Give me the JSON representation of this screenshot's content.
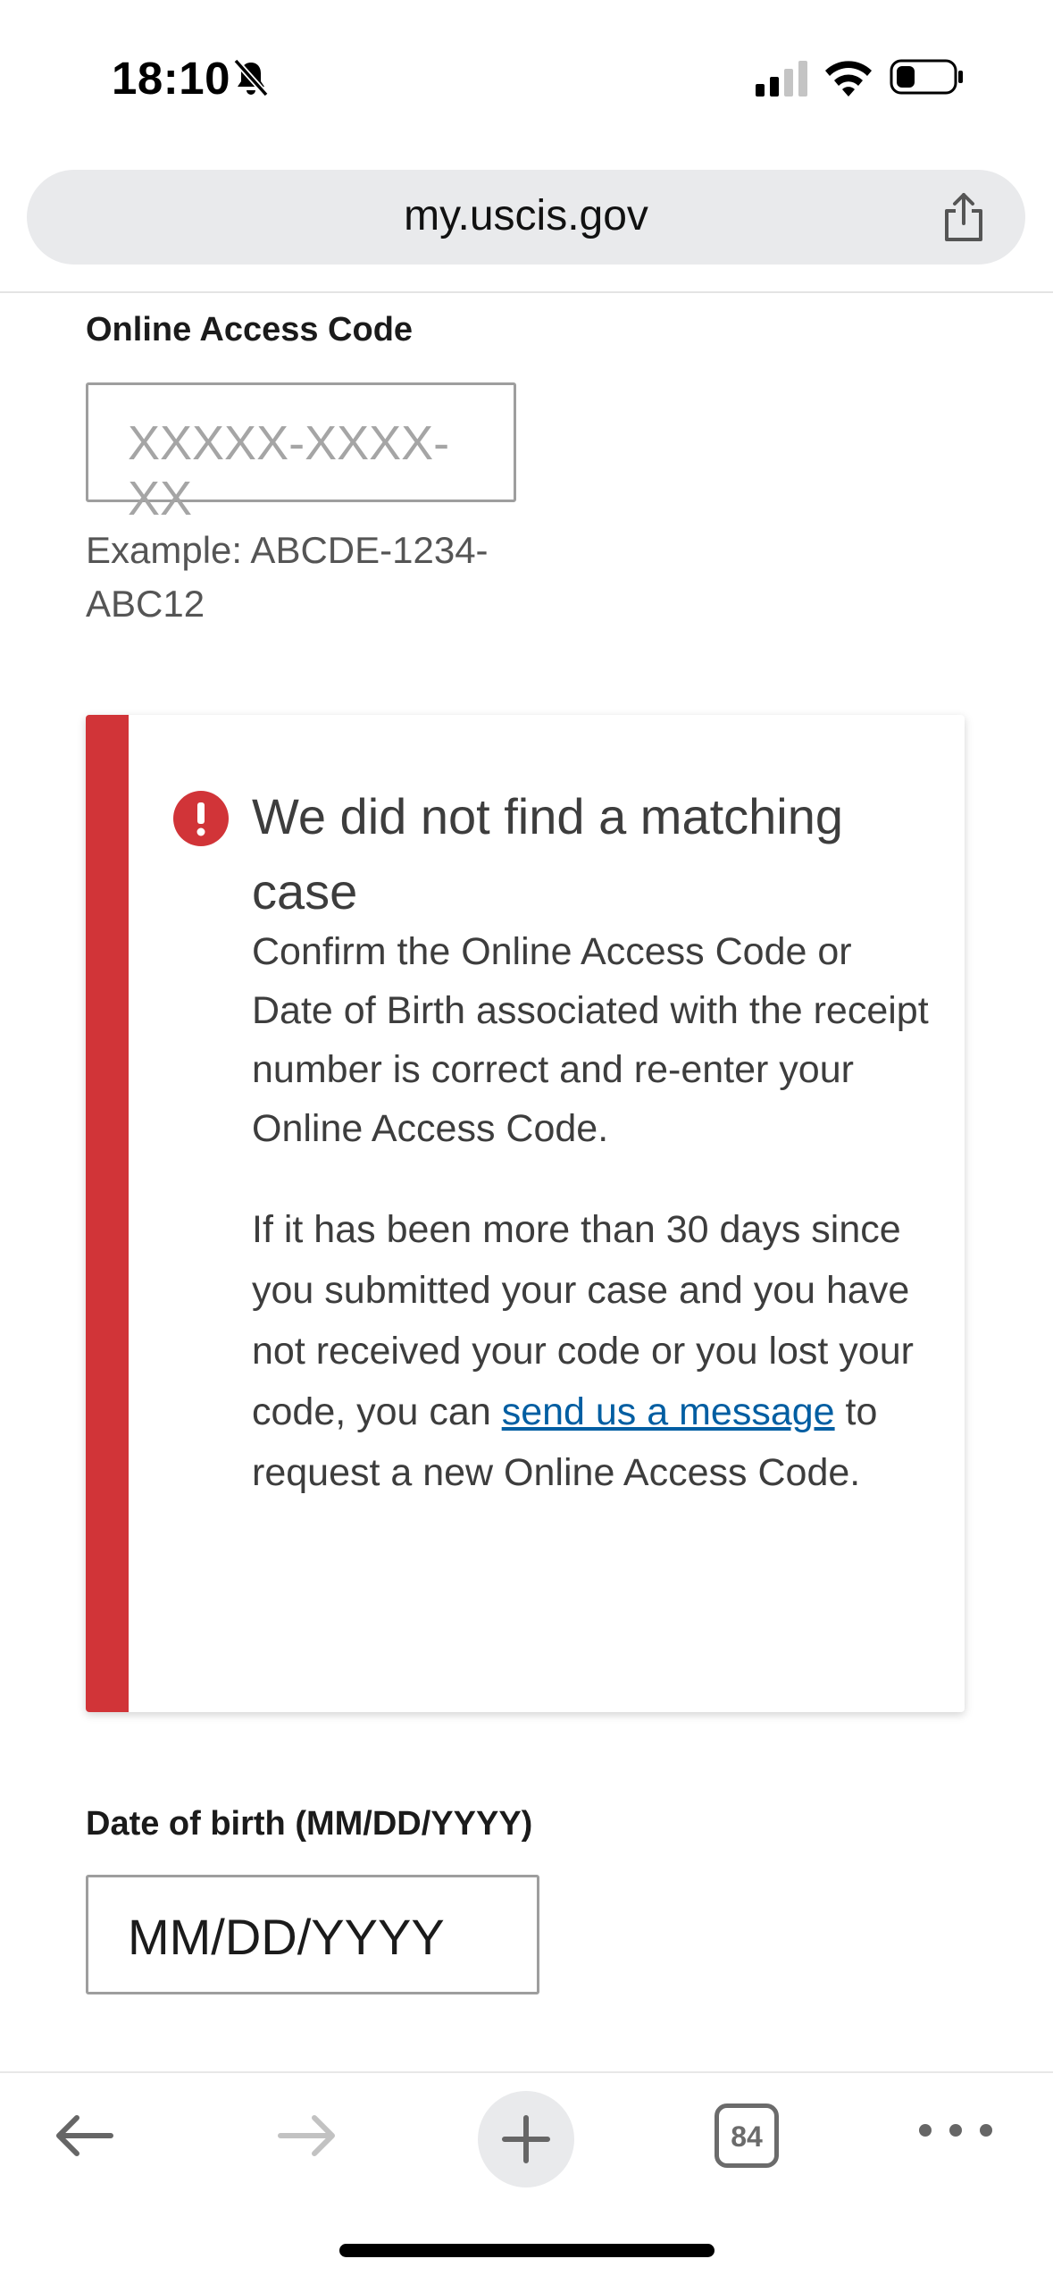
{
  "status": {
    "time": "18:10"
  },
  "browser": {
    "url": "my.uscis.gov",
    "tab_count": "84"
  },
  "form": {
    "access_code_label": "Online Access Code",
    "access_code_placeholder": "XXXXX-XXXX-XX",
    "access_code_hint": "Example: ABCDE-1234-ABC12",
    "dob_label": "Date of birth (MM/DD/YYYY)",
    "dob_value": "MM/DD/YYYY"
  },
  "alert": {
    "title": "We did not find a matching case",
    "body1": "Confirm the Online Access Code or Date of Birth associated with the receipt number is correct and re-enter your Online Access Code.",
    "body2_prefix": "If it has been more than 30 days since you submitted your case and you have not received your code or you lost your code, you can ",
    "body2_link": "send us a message",
    "body2_suffix": " to request a new Online Access Code.",
    "accent_color": "#d13438",
    "link_color": "#005ea2"
  }
}
